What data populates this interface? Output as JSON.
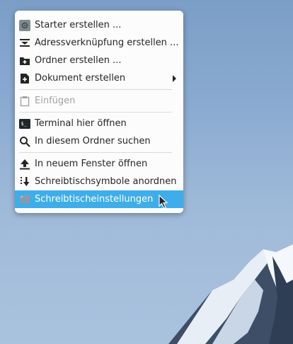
{
  "menu": {
    "items": [
      {
        "label": "Starter erstellen ...",
        "icon": "gear-icon",
        "disabled": false
      },
      {
        "label": "Adressverknüpfung erstellen ...",
        "icon": "link-icon",
        "disabled": false
      },
      {
        "label": "Ordner erstellen ...",
        "icon": "new-folder-icon",
        "disabled": false
      },
      {
        "label": "Dokument erstellen",
        "icon": "new-document-icon",
        "disabled": false,
        "submenu": true
      },
      {
        "label": "Einfügen",
        "icon": "paste-icon",
        "disabled": true
      },
      {
        "label": "Terminal hier öffnen",
        "icon": "terminal-icon",
        "disabled": false
      },
      {
        "label": "In diesem Ordner suchen",
        "icon": "search-icon",
        "disabled": false
      },
      {
        "label": "In neuem Fenster öffnen",
        "icon": "upload-arrow-icon",
        "disabled": false
      },
      {
        "label": "Schreibtischsymbole anordnen",
        "icon": "sort-icon",
        "disabled": false
      },
      {
        "label": "Schreibtischeinstellungen",
        "icon": "desktop-settings-icon",
        "disabled": false,
        "active": true
      }
    ]
  },
  "colors": {
    "highlight": "#3daee9",
    "menu_bg": "#fcfcfc",
    "text": "#232629",
    "disabled_text": "#a0a3a6"
  }
}
